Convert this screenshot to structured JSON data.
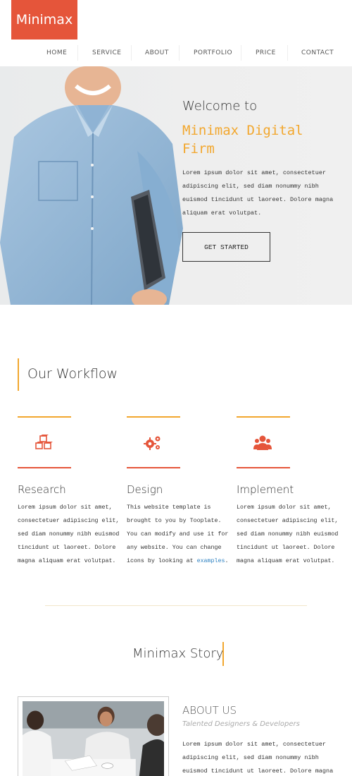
{
  "logo": {
    "text": "Minimax"
  },
  "nav": {
    "items": [
      {
        "label": "HOME"
      },
      {
        "label": "SERVICE"
      },
      {
        "label": "ABOUT"
      },
      {
        "label": "PORTFOLIO"
      },
      {
        "label": "PRICE"
      },
      {
        "label": "CONTACT"
      }
    ]
  },
  "hero": {
    "welcome": "Welcome to",
    "title": "Minimax Digital Firm",
    "text": "Lorem ipsum dolor sit amet, consectetuer adipiscing elit, sed diam nonummy nibh euismod tincidunt ut laoreet. Dolore magna aliquam erat volutpat.",
    "button": "GET STARTED"
  },
  "workflow": {
    "title": "Our Workflow",
    "columns": [
      {
        "title": "Research",
        "icon": "cubes-icon",
        "text": "Lorem ipsum dolor sit amet, consectetuer adipiscing elit, sed diam nonummy nibh euismod tincidunt ut laoreet. Dolore magna aliquam erat volutpat."
      },
      {
        "title": "Design",
        "icon": "gears-icon",
        "text_before": "This website template is brought to you by Tooplate. You can modify and use it for any website. You can change icons by looking at ",
        "link": "examples",
        "text_after": "."
      },
      {
        "title": "Implement",
        "icon": "users-icon",
        "text": "Lorem ipsum dolor sit amet, consectetuer adipiscing elit, sed diam nonummy nibh euismod tincidunt ut laoreet. Dolore magna aliquam erat volutpat."
      }
    ]
  },
  "story": {
    "title": "Minimax Story",
    "about_title": "ABOUT US",
    "about_sub": "Talented Designers & Developers",
    "about_text": "Lorem ipsum dolor sit amet, consectetuer adipiscing elit, sed diam nonummy nibh euismod tincidunt ut laoreet. Dolore magna aliquam erat"
  },
  "colors": {
    "accent": "#e5553a",
    "gold": "#f2a72e",
    "link": "#2a7fc0"
  }
}
